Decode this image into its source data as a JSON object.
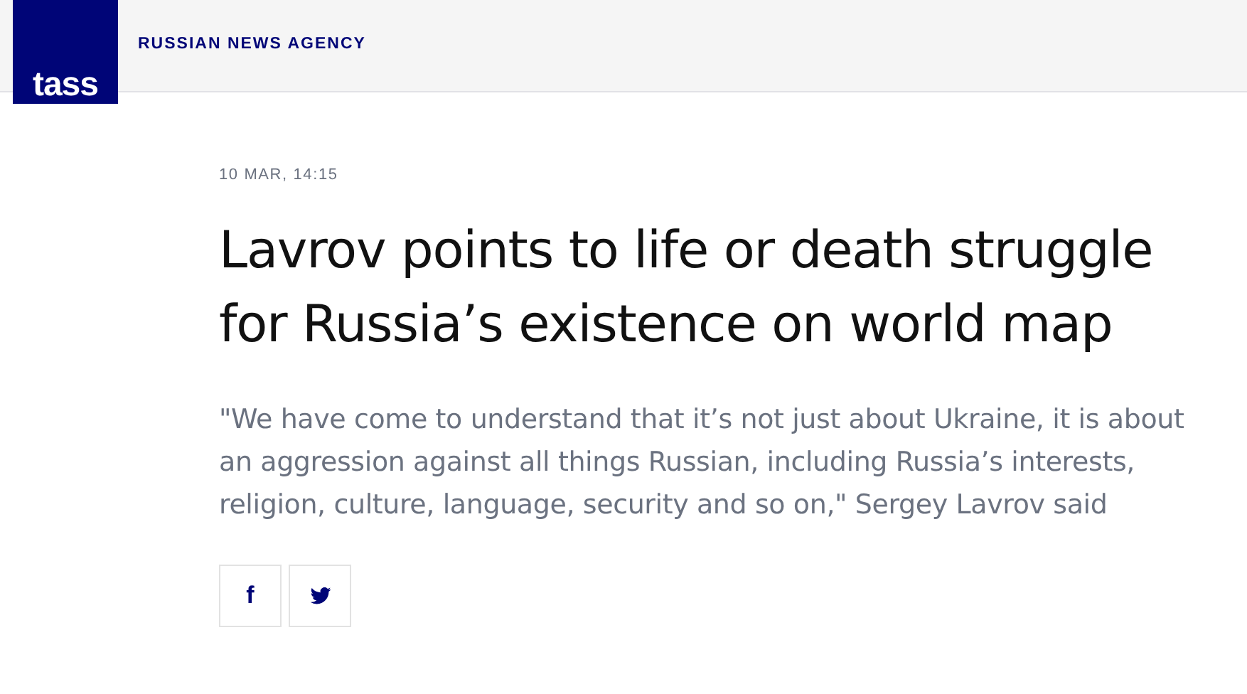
{
  "header": {
    "logo": "tass",
    "tagline": "RUSSIAN NEWS AGENCY"
  },
  "article": {
    "date": "10 MAR, 14:15",
    "title": "Lavrov points to life or death struggle for Russia’s existence on world map",
    "lead": "\"We have come to understand that it’s not just about Ukraine, it is about an aggression against all things Russian, including Russia’s interests, religion, culture, language, security and so on,\" Sergey Lavrov said"
  },
  "share_buttons": [
    {
      "kind": "facebook",
      "label": "f"
    },
    {
      "kind": "twitter"
    }
  ]
}
